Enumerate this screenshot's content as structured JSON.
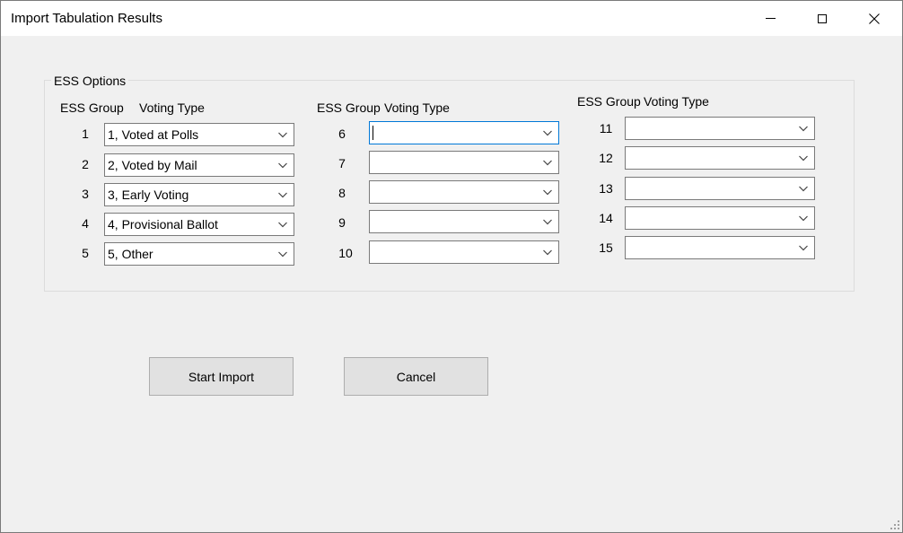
{
  "window": {
    "title": "Import Tabulation Results"
  },
  "groupbox": {
    "label": "ESS Options"
  },
  "columns": [
    {
      "ess_group_label": "ESS Group",
      "voting_type_label": "Voting Type",
      "rows": [
        {
          "group": "1",
          "value": "1, Voted at Polls"
        },
        {
          "group": "2",
          "value": "2, Voted by Mail"
        },
        {
          "group": "3",
          "value": "3, Early Voting"
        },
        {
          "group": "4",
          "value": "4, Provisional Ballot"
        },
        {
          "group": "5",
          "value": "5, Other"
        }
      ]
    },
    {
      "ess_group_label": "ESS Group",
      "voting_type_label": "Voting Type",
      "rows": [
        {
          "group": "6",
          "value": ""
        },
        {
          "group": "7",
          "value": ""
        },
        {
          "group": "8",
          "value": ""
        },
        {
          "group": "9",
          "value": ""
        },
        {
          "group": "10",
          "value": ""
        }
      ]
    },
    {
      "ess_group_label": "ESS Group",
      "voting_type_label": "Voting Type",
      "rows": [
        {
          "group": "11",
          "value": ""
        },
        {
          "group": "12",
          "value": ""
        },
        {
          "group": "13",
          "value": ""
        },
        {
          "group": "14",
          "value": ""
        },
        {
          "group": "15",
          "value": ""
        }
      ]
    }
  ],
  "buttons": {
    "start_import": "Start Import",
    "cancel": "Cancel"
  },
  "icons": {
    "minimize": "minimize-icon",
    "maximize": "maximize-icon",
    "close": "close-icon",
    "dropdown": "chevron-down-icon",
    "resize": "resize-grip-icon"
  },
  "colors": {
    "focus_border": "#0078d7",
    "button_face": "#e1e1e1",
    "window_bg": "#f0f0f0"
  }
}
